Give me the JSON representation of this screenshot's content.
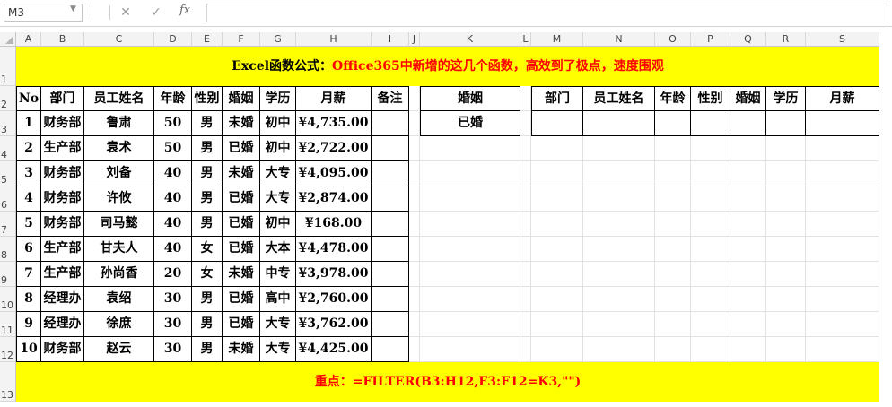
{
  "formula_bar": {
    "name_box": "M3",
    "fx_label": "fx",
    "cancel_glyph": "✕",
    "enter_glyph": "✓",
    "formula": ""
  },
  "columns": [
    "A",
    "B",
    "C",
    "D",
    "E",
    "F",
    "G",
    "H",
    "I",
    "J",
    "K",
    "L",
    "M",
    "N",
    "O",
    "P",
    "Q",
    "R",
    "S"
  ],
  "rows": [
    "1",
    "2",
    "3",
    "4",
    "5",
    "6",
    "7",
    "8",
    "9",
    "10",
    "11",
    "12",
    "13"
  ],
  "title": {
    "prefix": "Excel函数公式：",
    "text": "Office365中新增的这几个函数，高效到了极点，速度围观"
  },
  "main_table": {
    "headers": [
      "No",
      "部门",
      "员工姓名",
      "年龄",
      "性别",
      "婚姻",
      "学历",
      "月薪",
      "备注"
    ],
    "rows": [
      [
        "1",
        "财务部",
        "鲁肃",
        "50",
        "男",
        "未婚",
        "初中",
        "¥4,735.00",
        ""
      ],
      [
        "2",
        "生产部",
        "袁术",
        "50",
        "男",
        "已婚",
        "初中",
        "¥2,722.00",
        ""
      ],
      [
        "3",
        "财务部",
        "刘备",
        "40",
        "男",
        "未婚",
        "大专",
        "¥4,095.00",
        ""
      ],
      [
        "4",
        "财务部",
        "许攸",
        "40",
        "男",
        "已婚",
        "大专",
        "¥2,874.00",
        ""
      ],
      [
        "5",
        "财务部",
        "司马懿",
        "40",
        "男",
        "已婚",
        "初中",
        "¥168.00",
        ""
      ],
      [
        "6",
        "生产部",
        "甘夫人",
        "40",
        "女",
        "已婚",
        "大本",
        "¥4,478.00",
        ""
      ],
      [
        "7",
        "生产部",
        "孙尚香",
        "20",
        "女",
        "未婚",
        "中专",
        "¥3,978.00",
        ""
      ],
      [
        "8",
        "经理办",
        "袁绍",
        "30",
        "男",
        "已婚",
        "高中",
        "¥2,760.00",
        ""
      ],
      [
        "9",
        "经理办",
        "徐庶",
        "30",
        "男",
        "已婚",
        "大专",
        "¥3,762.00",
        ""
      ],
      [
        "10",
        "财务部",
        "赵云",
        "30",
        "男",
        "未婚",
        "大专",
        "¥4,425.00",
        ""
      ]
    ]
  },
  "criteria": {
    "header": "婚姻",
    "value": "已婚"
  },
  "result_table": {
    "headers": [
      "部门",
      "员工姓名",
      "年龄",
      "性别",
      "婚姻",
      "学历",
      "月薪"
    ]
  },
  "footer": {
    "label": "重点：",
    "formula": "=FILTER(B3:H12,F3:F12=K3,\"\")"
  }
}
